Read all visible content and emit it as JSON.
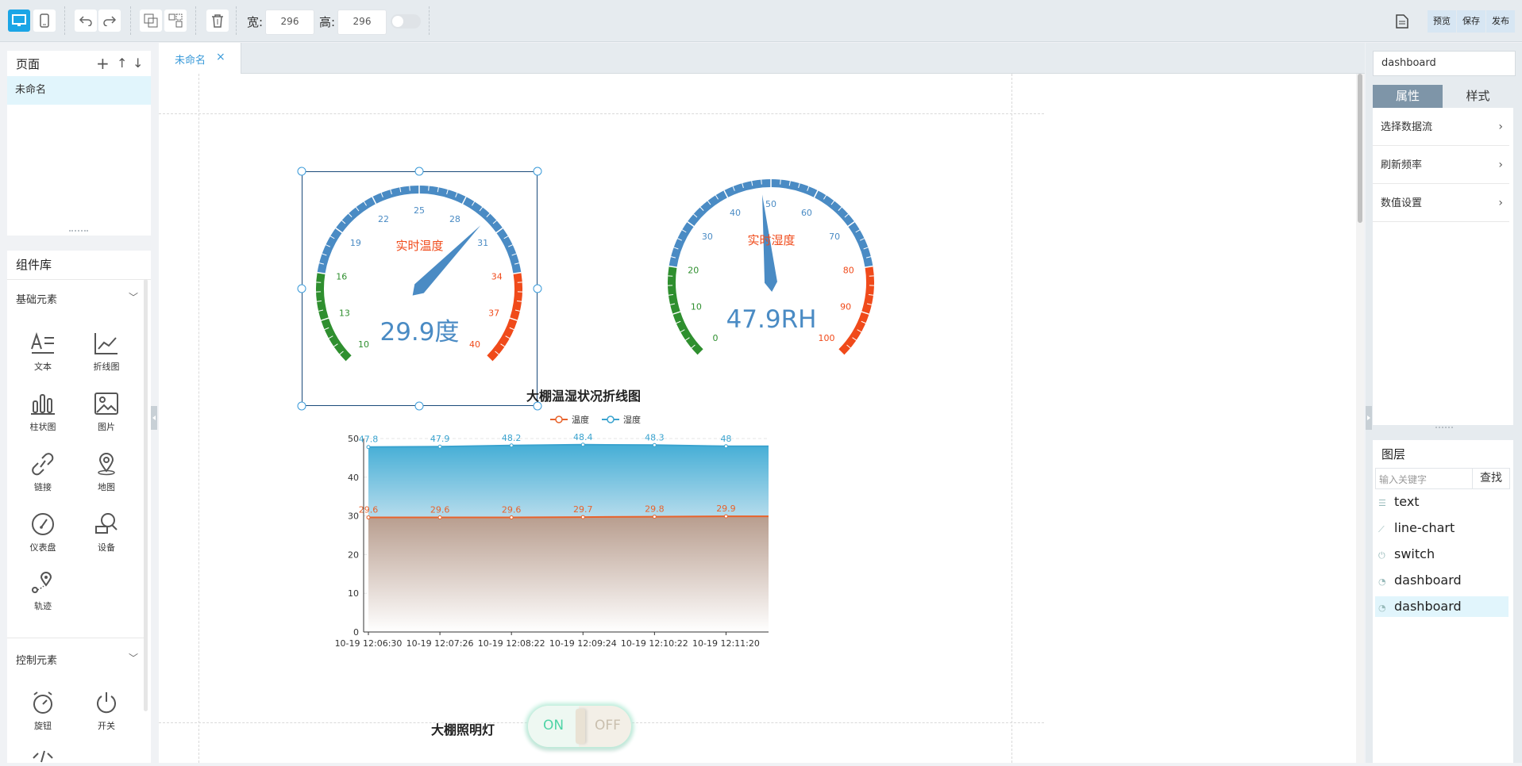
{
  "toolbar": {
    "width_label": "宽:",
    "width_value": "296",
    "height_label": "高:",
    "height_value": "296",
    "preview": "预览",
    "save": "保存",
    "publish": "发布"
  },
  "pages": {
    "title": "页面",
    "items": [
      "未命名"
    ]
  },
  "tabs": [
    {
      "label": "未命名",
      "close": "×"
    }
  ],
  "library": {
    "title": "组件库",
    "basic": {
      "title": "基础元素",
      "items": [
        {
          "label": "文本",
          "icon": "text-icon"
        },
        {
          "label": "折线图",
          "icon": "line-chart-icon"
        },
        {
          "label": "柱状图",
          "icon": "bar-chart-icon"
        },
        {
          "label": "图片",
          "icon": "image-icon"
        },
        {
          "label": "链接",
          "icon": "link-icon"
        },
        {
          "label": "地图",
          "icon": "map-pin-icon"
        },
        {
          "label": "仪表盘",
          "icon": "gauge-icon"
        },
        {
          "label": "设备",
          "icon": "device-icon"
        },
        {
          "label": "轨迹",
          "icon": "track-icon"
        }
      ]
    },
    "control": {
      "title": "控制元素",
      "items": [
        {
          "label": "旋钮",
          "icon": "knob-icon"
        },
        {
          "label": "开关",
          "icon": "power-icon"
        }
      ]
    }
  },
  "gauges": [
    {
      "title": "实时温度",
      "value": 29.9,
      "value_text": "29.9度",
      "min": 10,
      "max": 40,
      "ticks": [
        "10",
        "13",
        "16",
        "19",
        "22",
        "25",
        "28",
        "31",
        "34",
        "37",
        "40"
      ]
    },
    {
      "title": "实时湿度",
      "value": 47.9,
      "value_text": "47.9RH",
      "min": 0,
      "max": 100,
      "ticks": [
        "0",
        "10",
        "20",
        "30",
        "40",
        "50",
        "60",
        "70",
        "80",
        "90",
        "100"
      ]
    }
  ],
  "chart_data": {
    "type": "area",
    "title": "大棚温湿状况折线图",
    "legend": [
      "温度",
      "湿度"
    ],
    "x": [
      "10-19 12:06:30",
      "10-19 12:07:26",
      "10-19 12:08:22",
      "10-19 12:09:24",
      "10-19 12:10:22",
      "10-19 12:11:20"
    ],
    "series": [
      {
        "name": "温度",
        "values": [
          29.6,
          29.6,
          29.6,
          29.7,
          29.8,
          29.9
        ],
        "color": "#e8632c"
      },
      {
        "name": "湿度",
        "values": [
          47.8,
          47.9,
          48.2,
          48.4,
          48.3,
          48
        ],
        "color": "#3aa3cf"
      }
    ],
    "ylim": [
      0,
      50
    ],
    "yticks": [
      "0",
      "10",
      "20",
      "30",
      "40",
      "50"
    ],
    "grid": true,
    "legend_position": "top-center"
  },
  "switch": {
    "label": "大棚照明灯",
    "on": "ON",
    "off": "OFF"
  },
  "right": {
    "selected": "dashboard",
    "tabs": [
      "属性",
      "样式"
    ],
    "props": [
      "选择数据流",
      "刷新频率",
      "数值设置"
    ],
    "layers_title": "图层",
    "search_placeholder": "输入关键字",
    "search_button": "查找",
    "layers": [
      "text",
      "line-chart",
      "switch",
      "dashboard",
      "dashboard"
    ]
  },
  "colors": {
    "accent": "#1aa5e6",
    "gauge_blue": "#4a8bc4",
    "gauge_green": "#2f8f2f",
    "gauge_red": "#f04a1a"
  }
}
